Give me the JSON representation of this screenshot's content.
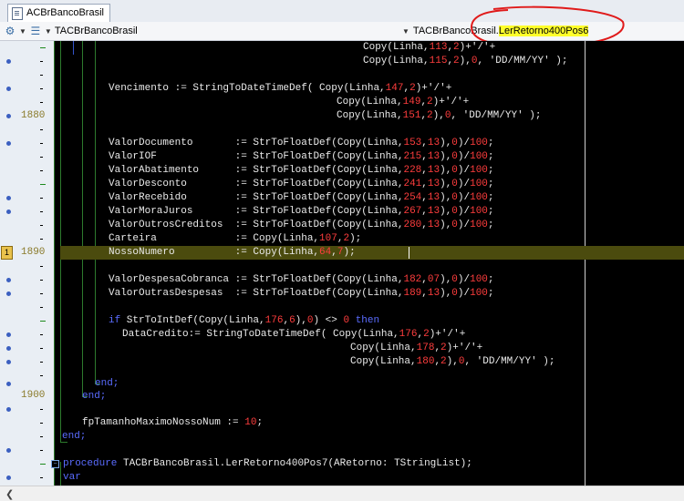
{
  "tab": {
    "label": "ACBrBancoBrasil"
  },
  "nav": {
    "unit": "TACBrBancoBrasil",
    "method_prefix": "TACBrBancoBrasil.",
    "method_name": "LerRetorno400Pos6"
  },
  "gutter": {
    "n1880": "1880",
    "n1890": "1890",
    "n1900": "1900",
    "bookmark": "1"
  },
  "code": {
    "l0a": "Copy(Linha,",
    "l0n1": "113",
    "l0b": ",",
    "l0n2": "2",
    "l0c": ")+'/'+",
    "l1a": "Copy(Linha,",
    "l1n1": "115",
    "l1b": ",",
    "l1n2": "2",
    "l1c": "),",
    "l1n3": "0",
    "l1d": ", 'DD/MM/YY' );",
    "l3a": "Vencimento := StringToDateTimeDef( Copy(Linha,",
    "l3n1": "147",
    "l3b": ",",
    "l3n2": "2",
    "l3c": ")+'/'+",
    "l4a": "Copy(Linha,",
    "l4n1": "149",
    "l4b": ",",
    "l4n2": "2",
    "l4c": ")+'/'+",
    "l5a": "Copy(Linha,",
    "l5n1": "151",
    "l5b": ",",
    "l5n2": "2",
    "l5c": "),",
    "l5n3": "0",
    "l5d": ", 'DD/MM/YY' );",
    "fields": [
      {
        "name": "ValorDocumento     ",
        "n1": "153",
        "n2": "13",
        "n3": "0",
        "n4": "100"
      },
      {
        "name": "ValorIOF           ",
        "n1": "215",
        "n2": "13",
        "n3": "0",
        "n4": "100"
      },
      {
        "name": "ValorAbatimento    ",
        "n1": "228",
        "n2": "13",
        "n3": "0",
        "n4": "100"
      },
      {
        "name": "ValorDesconto      ",
        "n1": "241",
        "n2": "13",
        "n3": "0",
        "n4": "100"
      },
      {
        "name": "ValorRecebido      ",
        "n1": "254",
        "n2": "13",
        "n3": "0",
        "n4": "100"
      },
      {
        "name": "ValorMoraJuros     ",
        "n1": "267",
        "n2": "13",
        "n3": "0",
        "n4": "100"
      },
      {
        "name": "ValorOutrosCreditos",
        "n1": "280",
        "n2": "13",
        "n3": "0",
        "n4": "100"
      }
    ],
    "assign_float": "  := StrToFloatDef(Copy(Linha,",
    "carteira_a": "Carteira             := Copy(Linha,",
    "carteira_n1": "107",
    "carteira_b": ",",
    "carteira_n2": "2",
    "carteira_c": ");",
    "nosso_a": "NossoNumero          := Copy(Linha,",
    "nosso_n1": "64",
    "nosso_b": ",",
    "nosso_n2": "7",
    "nosso_c": ");",
    "fields2": [
      {
        "name": "ValorDespesaCobranca",
        "sep": " := StrToFloatDef(Copy(Linha,",
        "n1": "182",
        "n2": "07",
        "n3": "0",
        "n4": "100"
      },
      {
        "name": "ValorOutrasDespesas ",
        "sep": " := StrToFloatDef(Copy(Linha,",
        "n1": "189",
        "n2": "13",
        "n3": "0",
        "n4": "100"
      }
    ],
    "if_kw": "if",
    "if_a": " StrToIntDef(Copy(Linha,",
    "if_n1": "176",
    "if_b": ",",
    "if_n2": "6",
    "if_c": "),",
    "if_n3": "0",
    "if_d": ") <> ",
    "if_n4": "0",
    "then_kw": " then",
    "dc_a": "DataCredito:= StringToDateTimeDef( Copy(Linha,",
    "dc_n1": "176",
    "dc_b": ",",
    "dc_n2": "2",
    "dc_c": ")+'/'+",
    "dc2_a": "Copy(Linha,",
    "dc2_n1": "178",
    "dc2_b": ",",
    "dc2_n2": "2",
    "dc2_c": ")+'/'+",
    "dc3_a": "Copy(Linha,",
    "dc3_n1": "180",
    "dc3_b": ",",
    "dc3_n2": "2",
    "dc3_c": "),",
    "dc3_n3": "0",
    "dc3_d": ", 'DD/MM/YY' );",
    "end1": "end;",
    "end2": "end;",
    "fp_a": "fpTamanhoMaximoNossoNum := ",
    "fp_n": "10",
    "fp_b": ";",
    "end3": "end;",
    "proc_kw": "procedure",
    "proc_a": " TACBrBancoBrasil.LerRetorno400Pos7(ARetorno: TStringList);",
    "var_kw": "var"
  }
}
